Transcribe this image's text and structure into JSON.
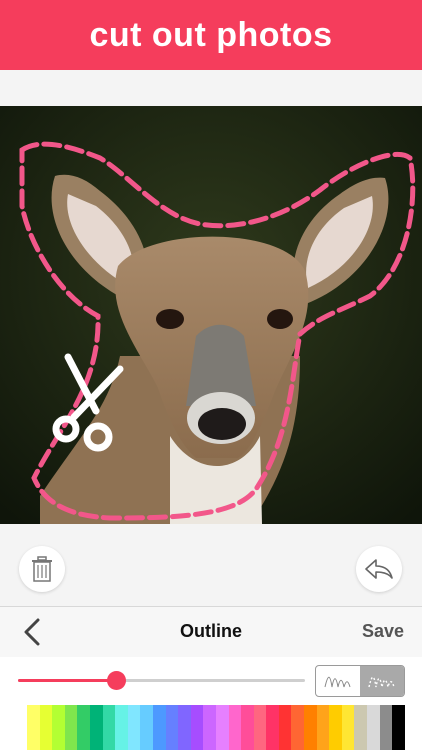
{
  "banner": {
    "title": "cut out photos",
    "color": "#f53d5c"
  },
  "toolbar": {
    "delete_icon": "trash-icon",
    "undo_icon": "undo-arrow-icon"
  },
  "nav": {
    "title": "Outline",
    "save_label": "Save",
    "back_icon": "chevron-left-icon"
  },
  "controls": {
    "slider_value": 0.34,
    "modes": [
      {
        "icon": "thin-stroke-icon",
        "selected": false
      },
      {
        "icon": "dotted-stroke-icon",
        "selected": true
      }
    ]
  },
  "palette": [
    "#ffff66",
    "#e6ff33",
    "#b3ff33",
    "#7fe64d",
    "#33cc66",
    "#00b377",
    "#33d9a6",
    "#66f2e6",
    "#80e6ff",
    "#66ccff",
    "#4d99ff",
    "#6680ff",
    "#8066ff",
    "#a64dff",
    "#cc66ff",
    "#e680ff",
    "#ff66cc",
    "#ff4d99",
    "#ff6680",
    "#ff3366",
    "#ff3333",
    "#ff6633",
    "#ff8000",
    "#ffa31a",
    "#ffcc00",
    "#ffe633",
    "#ccc8b0",
    "#d9d9d9",
    "#8c8c8c",
    "#000000"
  ]
}
